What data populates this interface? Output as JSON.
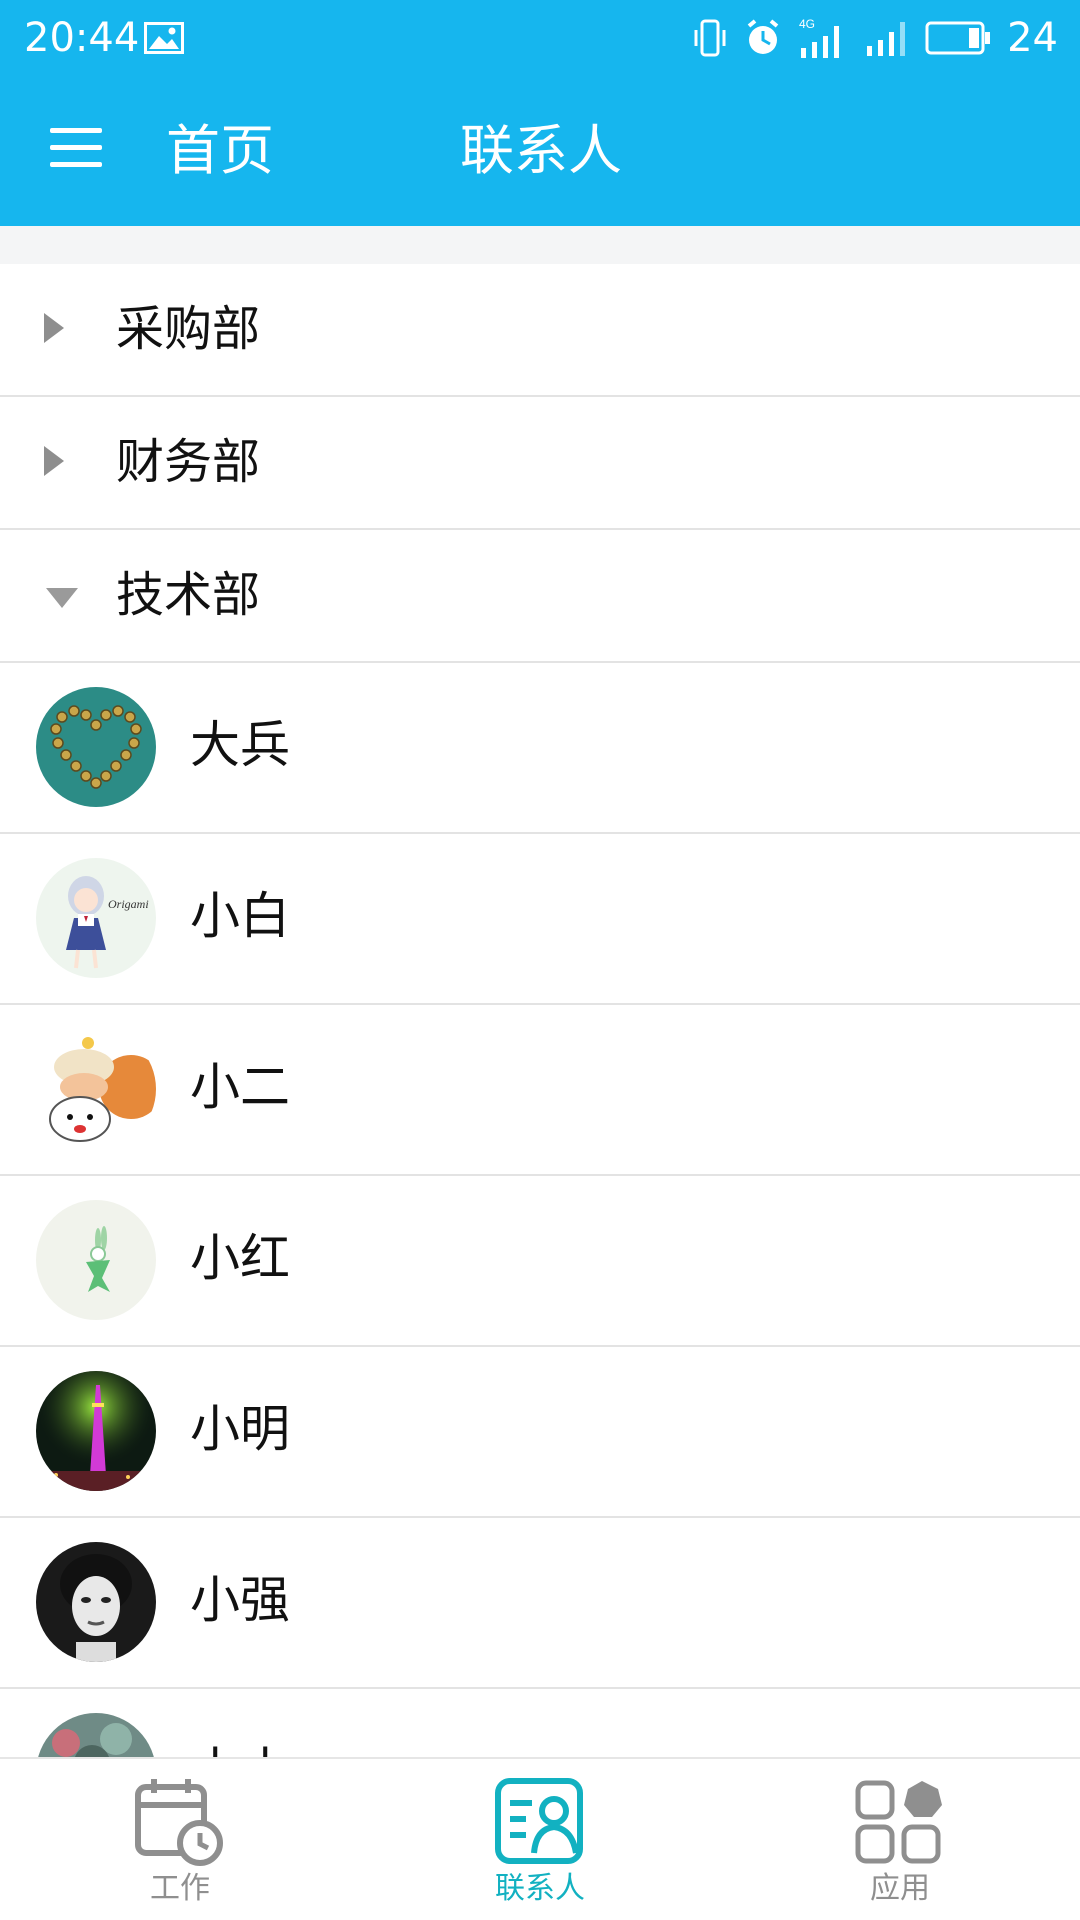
{
  "status_bar": {
    "time": "20:44",
    "battery": "24",
    "network": "4G"
  },
  "app_bar": {
    "home_label": "首页",
    "title": "联系人"
  },
  "groups": [
    {
      "name": "采购部",
      "expanded": false
    },
    {
      "name": "财务部",
      "expanded": false
    },
    {
      "name": "技术部",
      "expanded": true
    }
  ],
  "contacts": [
    {
      "name": "大兵"
    },
    {
      "name": "小白"
    },
    {
      "name": "小二"
    },
    {
      "name": "小红"
    },
    {
      "name": "小明"
    },
    {
      "name": "小强"
    },
    {
      "name": "小小"
    }
  ],
  "bottom_nav": [
    {
      "label": "工作",
      "icon": "calendar-clock-icon",
      "active": false
    },
    {
      "label": "联系人",
      "icon": "contacts-icon",
      "active": true
    },
    {
      "label": "应用",
      "icon": "apps-grid-icon",
      "active": false
    }
  ],
  "colors": {
    "primary": "#16b6ee",
    "active_tab": "#12b1c1",
    "inactive_tab": "#8f8f8f"
  }
}
